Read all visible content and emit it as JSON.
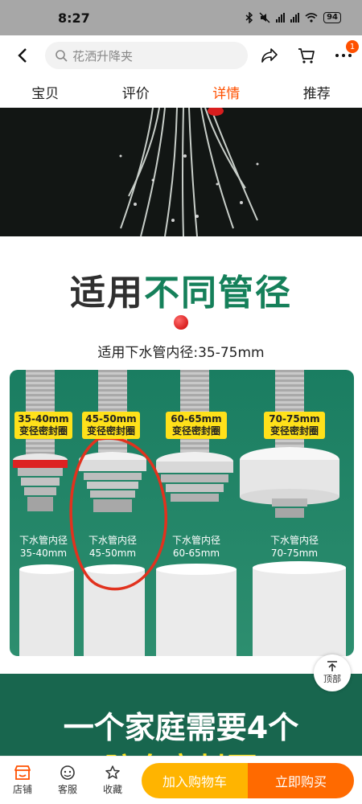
{
  "status": {
    "time": "8:27",
    "battery": "94"
  },
  "nav": {
    "search_text": "花洒升降夹",
    "cart_badge": "1"
  },
  "tabs": [
    {
      "label": "宝贝"
    },
    {
      "label": "评价"
    },
    {
      "label": "详情",
      "active": true
    },
    {
      "label": "推荐"
    }
  ],
  "content": {
    "title_plain": "适用",
    "title_highlight": "不同管径",
    "subtitle": "适用下水管内径:35-75mm",
    "products": [
      {
        "tag_line1": "35-40mm",
        "tag_line2": "变径密封圈",
        "caption_line1": "下水管内径",
        "caption_line2": "35-40mm"
      },
      {
        "tag_line1": "45-50mm",
        "tag_line2": "变径密封圈",
        "caption_line1": "下水管内径",
        "caption_line2": "45-50mm"
      },
      {
        "tag_line1": "60-65mm",
        "tag_line2": "变径密封圈",
        "caption_line1": "下水管内径",
        "caption_line2": "60-65mm"
      },
      {
        "tag_line1": "70-75mm",
        "tag_line2": "变径密封圈",
        "caption_line1": "下水管内径",
        "caption_line2": "70-75mm"
      }
    ],
    "banner_line1": "一个家庭需要4个",
    "banner_line2": "防臭密封圈",
    "back_top_label": "顶部"
  },
  "bottom": {
    "store_label": "店铺",
    "service_label": "客服",
    "favorite_label": "收藏",
    "add_cart_label": "加入购物车",
    "buy_now_label": "立即购买"
  },
  "colors": {
    "accent": "#ff5000",
    "cart_button": "#ffb400",
    "buy_button": "#ff6a00",
    "panel_green": "#1a7d61",
    "tag_yellow": "#ffe11a"
  }
}
